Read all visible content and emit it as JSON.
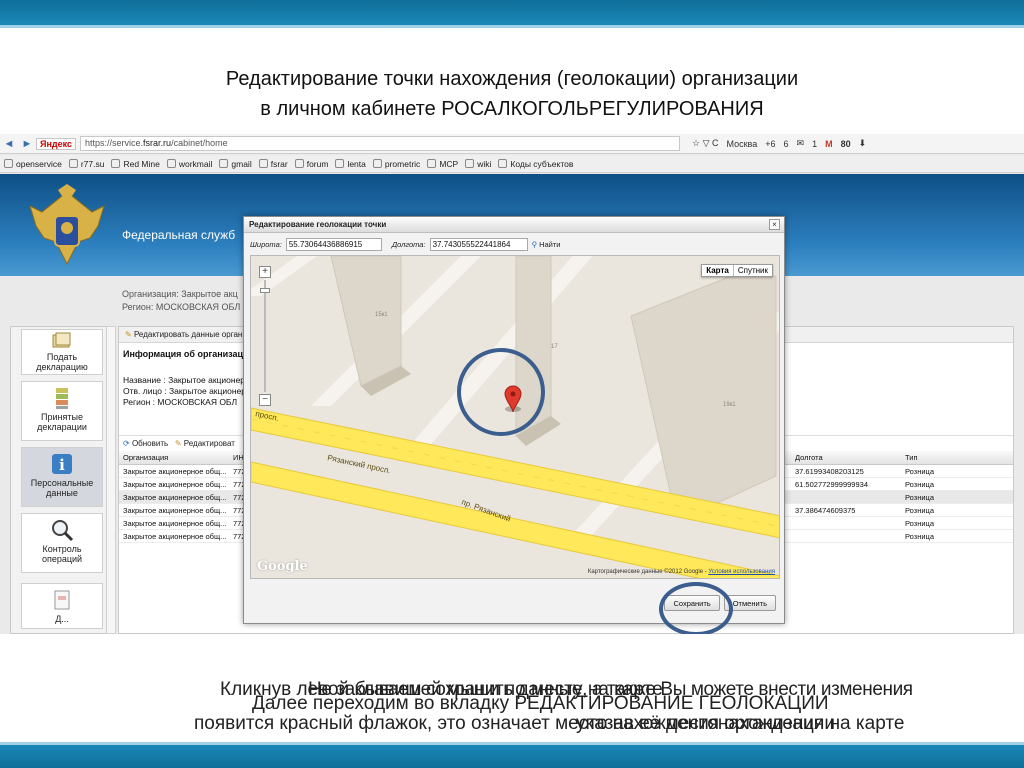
{
  "slide": {
    "title_line1": "Редактирование точки нахождения (геолокации) организации",
    "title_line2": "в личном кабинете РОСАЛКОГОЛЬРЕГУЛИРОВАНИЯ",
    "caption_layers": [
      "Кликнув левой клавишей мыши по месту на карте",
      "Не забываем сохранить данные, а также Вы можете внести изменения",
      "Далее переходим во вкладку РЕДАКТИРОВАНИЕ ГЕОЛОКАЦИИ",
      "появится красный флажок, это означает место нахождения организации",
      "указав её местонахождения на карте"
    ],
    "colors": {
      "band": "#1b87b6",
      "ring": "#3b5e8e",
      "header": "#2d80bf"
    }
  },
  "browser": {
    "nav_back": "◄",
    "nav_forward": "►",
    "yandex_label": "Яндекс",
    "url_prefix": "https://service.",
    "url_domain": "fsrar.ru",
    "url_path": "/cabinet/home",
    "weather": "Москва",
    "temperature": "+6",
    "counter_1": "6",
    "mail_count": "1",
    "gmail_count": "80",
    "bookmarks": [
      "openservice",
      "r77.su",
      "Red Mine",
      "workmail",
      "gmail",
      "fsrar",
      "forum",
      "lenta",
      "prometric",
      "MCP",
      "wiki",
      "Коды субъектов"
    ]
  },
  "site": {
    "header_name": "Федеральная служб",
    "org_line": "Организация: Закрытое акц",
    "region_line": "Регион: МОСКОВСКАЯ ОБЛ"
  },
  "sidebar": {
    "items": [
      {
        "label": "Подать декларацию",
        "icon": "papers-icon"
      },
      {
        "label": "Принятые декларации",
        "icon": "books-icon"
      },
      {
        "label": "Персональные данные",
        "icon": "info-icon"
      },
      {
        "label": "Контроль операций",
        "icon": "magnifier-icon"
      },
      {
        "label": "Д...",
        "icon": "document-icon"
      }
    ]
  },
  "main": {
    "edit_button": "Редактировать данные орган",
    "info_heading": "Информация об организаци",
    "name_line": "Название : Закрытое акционер",
    "person_line": "Отв. лицо : Закрытое акционер",
    "region_line": "Регион : МОСКОВСКАЯ ОБЛ",
    "refresh_button": "Обновить",
    "edit_row_button": "Редактироват",
    "columns": {
      "org": "Организация",
      "inn": "ИН",
      "lon": "Долгота",
      "type": "Тип"
    },
    "rows": [
      {
        "org": "Закрытое акционерное общ...",
        "inn": "772",
        "lon": "37.61993408203125",
        "type": "Розница",
        "sel": false
      },
      {
        "org": "Закрытое акционерное общ...",
        "inn": "772",
        "lon": "61.502772999999934",
        "type": "Розница",
        "sel": false
      },
      {
        "org": "Закрытое акционерное общ...",
        "inn": "772",
        "lon": "",
        "type": "Розница",
        "sel": true
      },
      {
        "org": "Закрытое акционерное общ...",
        "inn": "772",
        "lon": "37.386474609375",
        "type": "Розница",
        "sel": false
      },
      {
        "org": "Закрытое акционерное общ...",
        "inn": "772",
        "lon": "",
        "type": "Розница",
        "sel": false
      },
      {
        "org": "Закрытое акционерное общ...",
        "inn": "772",
        "lon": "",
        "type": "Розница",
        "sel": false
      }
    ]
  },
  "dialog": {
    "title": "Редактирование геолокации точки",
    "close": "×",
    "lat_label": "Широта:",
    "lat_value": "55.7306443688691​5",
    "lon_label": "Долгота:",
    "lon_value": "37.743055522441864",
    "find_button": "Найти",
    "map_type_map": "Карта",
    "map_type_sat": "Спутник",
    "zoom_in": "+",
    "zoom_out": "−",
    "building_1": "15к1",
    "building_2": "17",
    "building_3": "19к1",
    "street_1": "Рязанский просп.",
    "street_2": "пр. Рязанский",
    "street_3": "просп.",
    "google_logo": "Google",
    "attribution": "Картографические данные ©2012 Google - ",
    "terms": "Условия использования",
    "save_button": "Сохранить",
    "cancel_button": "Отменить"
  }
}
